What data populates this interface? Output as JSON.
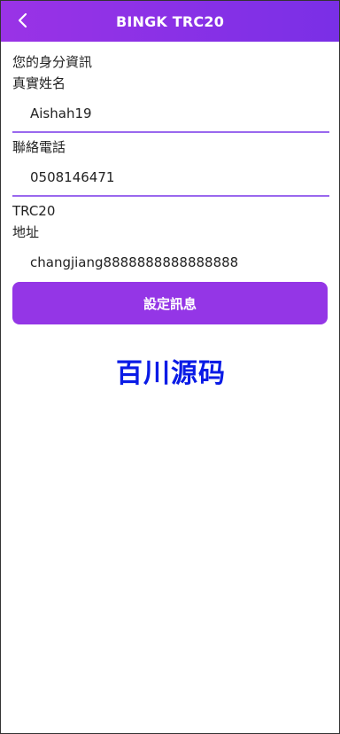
{
  "header": {
    "title": "BINGK TRC20",
    "back_icon": "chevron-left-icon",
    "background": "#8a33e6"
  },
  "section": {
    "heading": "您的身分資訊",
    "fields": [
      {
        "label": "真實姓名",
        "value": "Aishah19"
      },
      {
        "label": "聯絡電話",
        "value": "0508146471"
      },
      {
        "label": "TRC20",
        "sublabel": "地址",
        "value": "changjiang8888888888888888"
      }
    ]
  },
  "actions": {
    "submit_label": "設定訊息",
    "accent": "#9436e6"
  },
  "branding": {
    "watermark_text": "百川源码",
    "color": "#0a1be6"
  }
}
